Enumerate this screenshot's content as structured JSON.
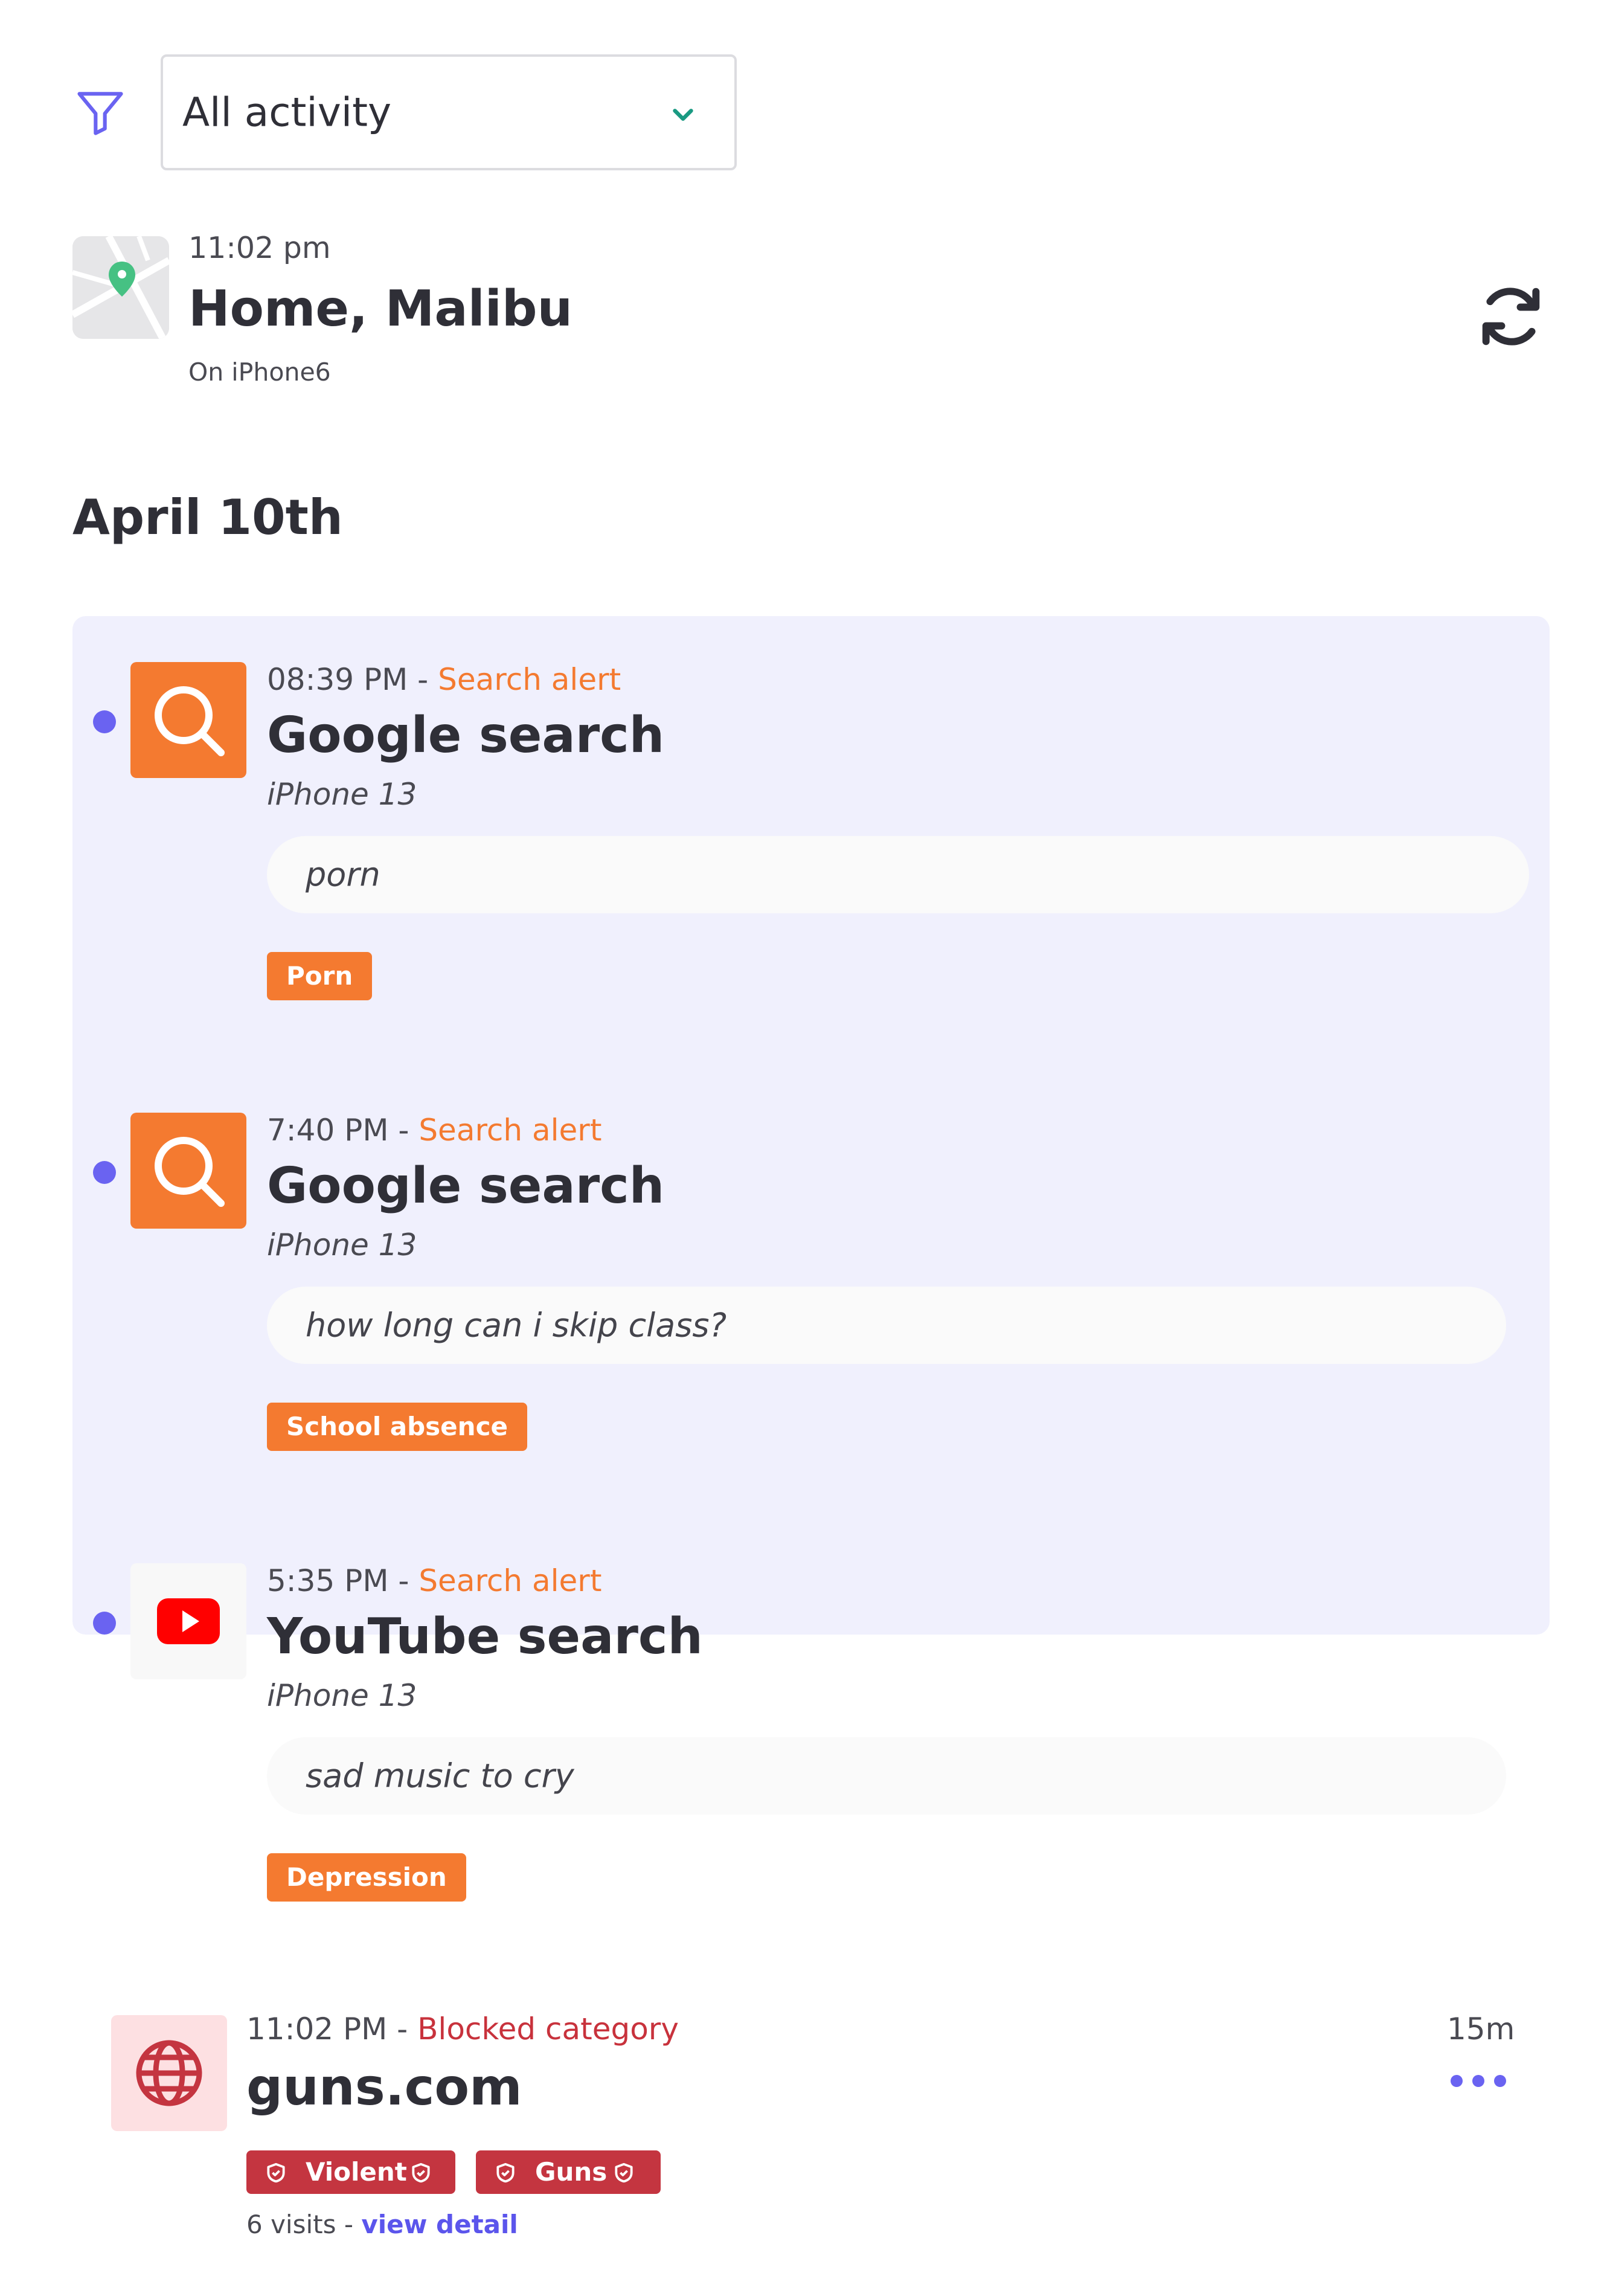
{
  "filter": {
    "icon": "filter-icon",
    "selected": "All activity",
    "chevron_icon": "chevron-down-icon"
  },
  "location": {
    "icon": "map-pin-icon",
    "time": "11:02 pm",
    "title": "Home, Malibu",
    "device": "On iPhone6",
    "refresh_icon": "refresh-icon"
  },
  "date_heading": "April 10th",
  "alerts": [
    {
      "time": "08:39 PM",
      "separator": " - ",
      "alert_type": "Search alert",
      "title": "Google search",
      "device": "iPhone 13",
      "query": "porn",
      "tag": "Porn",
      "icon": "search-icon"
    },
    {
      "time": "7:40 PM",
      "separator": " - ",
      "alert_type": "Search alert",
      "title": "Google search",
      "device": "iPhone 13",
      "query": "how long can i skip class?",
      "tag": "School absence",
      "icon": "search-icon"
    },
    {
      "time": "5:35 PM",
      "separator": " - ",
      "alert_type": "Search alert",
      "title": "YouTube search",
      "device": "iPhone 13",
      "query": "sad music to cry",
      "tag": "Depression",
      "icon": "youtube-icon"
    }
  ],
  "blocked": {
    "time": "11:02 PM",
    "separator": " - ",
    "alert_type": "Blocked category",
    "title": "guns.com",
    "duration": "15m",
    "icon": "globe-icon",
    "more_icon": "more-icon",
    "badges": [
      "Violent",
      "Guns"
    ],
    "visits": "6 visits",
    "visits_separator": " - ",
    "detail_link": "view detail"
  },
  "colors": {
    "accent": "#6a63f1",
    "alert_orange": "#f47a30",
    "blocked_red": "#c43540",
    "panel_bg": "#f0f0fd",
    "link": "#5b55ec"
  }
}
